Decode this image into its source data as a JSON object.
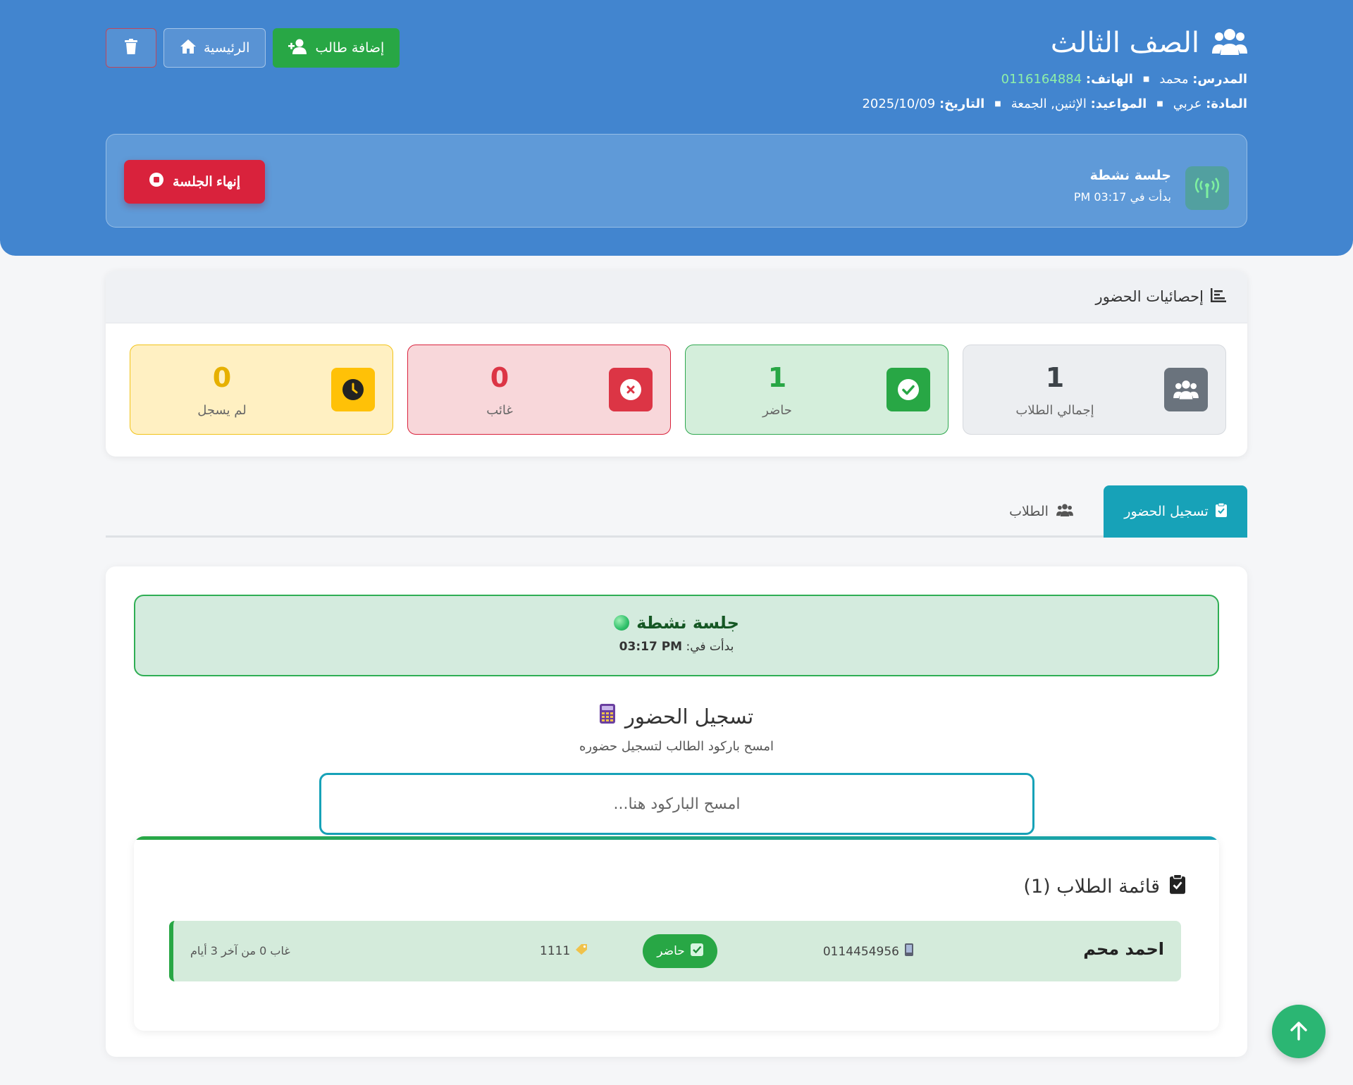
{
  "header": {
    "title": "الصف الثالث",
    "teacher_label": "المدرس:",
    "teacher_value": "محمد",
    "phone_label": "الهاتف:",
    "phone_value": "0116164884",
    "subject_label": "المادة:",
    "subject_value": "عربي",
    "schedule_label": "المواعيد:",
    "schedule_value": "الإثنين, الجمعة",
    "date_label": "التاريخ:",
    "date_value": "2025/10/09",
    "add_student_label": "إضافة طالب",
    "home_label": "الرئيسية"
  },
  "session": {
    "title": "جلسة نشطة",
    "started_at": "بدأت في 03:17 PM",
    "end_label": "إنهاء الجلسة"
  },
  "stats": {
    "title": "إحصائيات الحضور",
    "total": {
      "value": "1",
      "label": "إجمالي الطلاب"
    },
    "present": {
      "value": "1",
      "label": "حاضر"
    },
    "absent": {
      "value": "0",
      "label": "غائب"
    },
    "pending": {
      "value": "0",
      "label": "لم يسجل"
    }
  },
  "tabs": {
    "attendance": "تسجيل الحضور",
    "students": "الطلاب"
  },
  "main": {
    "live_title": "جلسة نشطة",
    "live_started_prefix": "بدأت في:",
    "live_started_time": "03:17 PM",
    "scan_title": "تسجيل الحضور",
    "scan_subtitle": "امسح باركود الطالب لتسجيل حضوره",
    "scan_placeholder": "امسح الباركود هنا...",
    "list_title": "قائمة الطلاب (1)",
    "students": [
      {
        "name": "احمد محم",
        "phone": "0114454956",
        "status": "حاضر",
        "code": "1111",
        "absence": "غاب 0 من آخر 3 أيام"
      }
    ]
  },
  "colors": {
    "header_bg": "#4285cf",
    "success": "#28a745",
    "danger": "#dc3545",
    "warning": "#ffc107",
    "info": "#17a2b8"
  }
}
